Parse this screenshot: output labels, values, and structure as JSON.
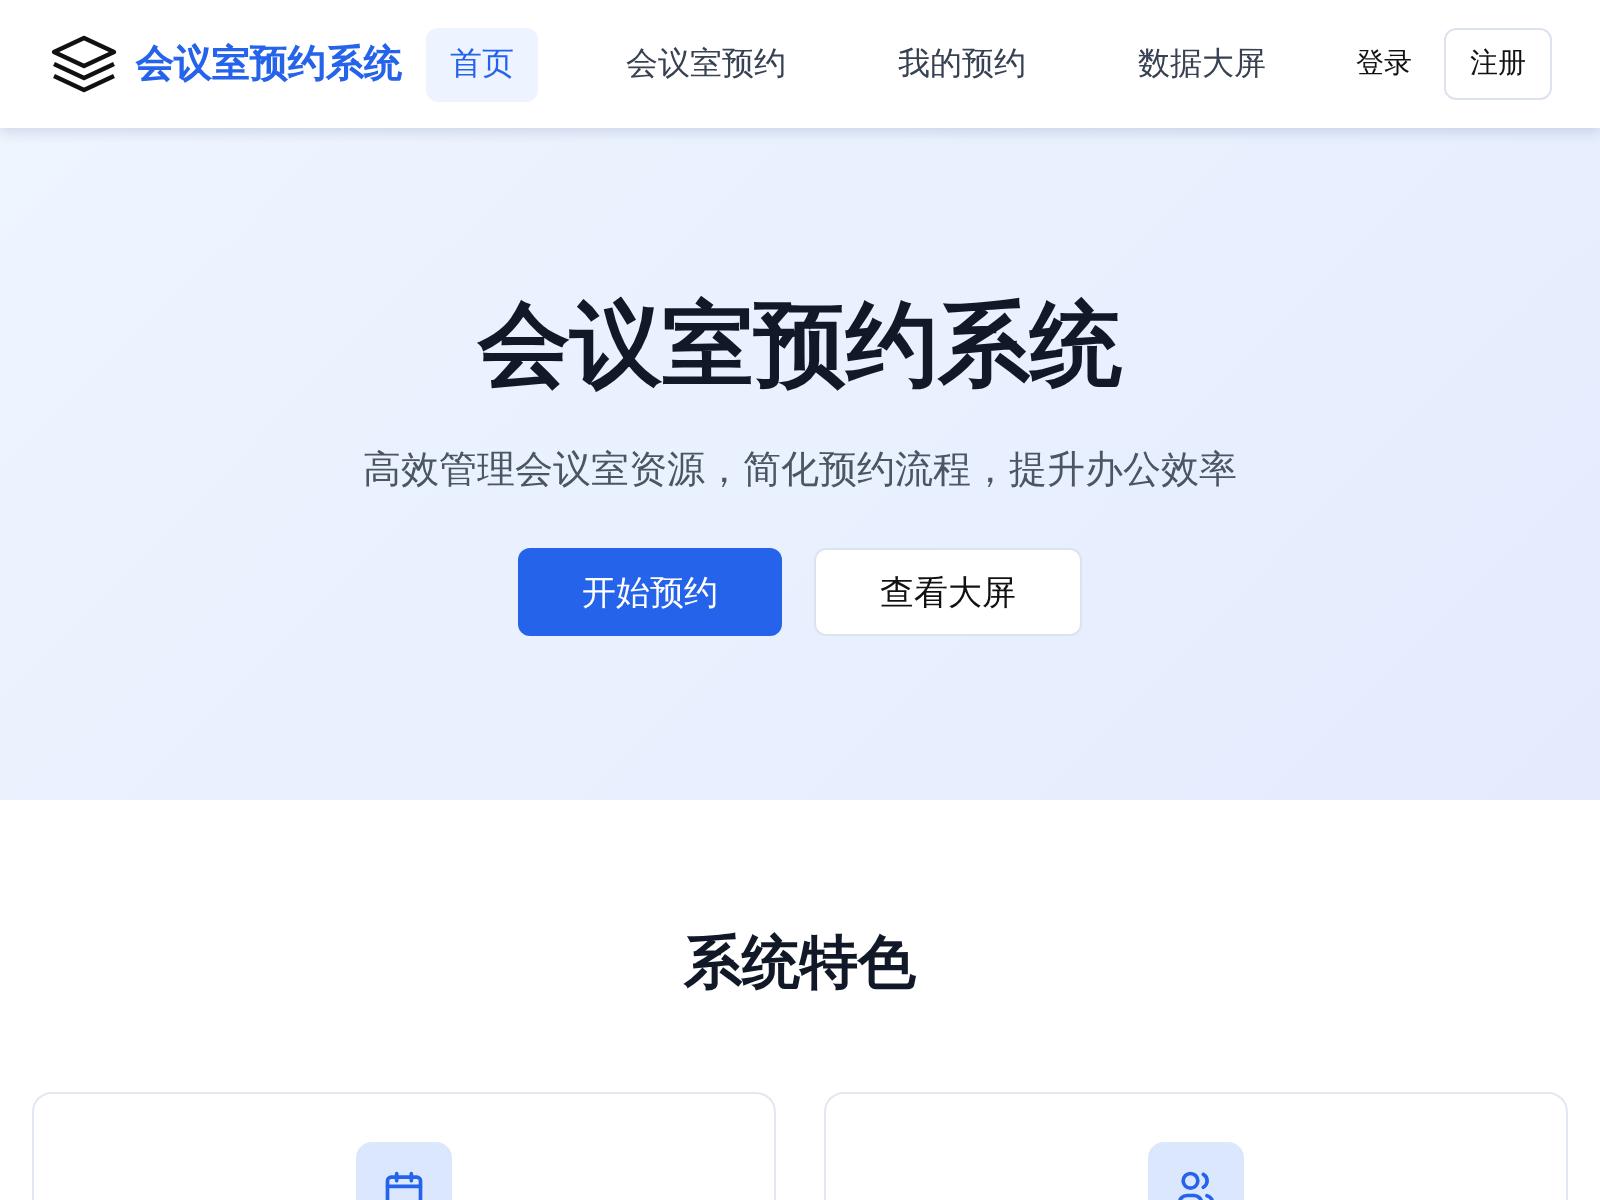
{
  "header": {
    "brand": "会议室预约系统",
    "nav": [
      {
        "label": "首页",
        "selected": true
      },
      {
        "label": "会议室预约",
        "selected": false
      },
      {
        "label": "我的预约",
        "selected": false
      },
      {
        "label": "数据大屏",
        "selected": false
      }
    ],
    "login": "登录",
    "register": "注册"
  },
  "hero": {
    "title": "会议室预约系统",
    "subtitle": "高效管理会议室资源，简化预约流程，提升办公效率",
    "primary_button": "开始预约",
    "secondary_button": "查看大屏"
  },
  "features": {
    "title": "系统特色",
    "cards": [
      {
        "kind": "calendar"
      },
      {
        "kind": "users"
      }
    ]
  }
}
